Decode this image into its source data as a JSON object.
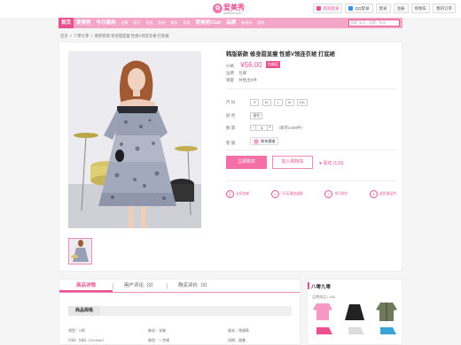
{
  "brand": {
    "name": "爱美秀",
    "domain": "aimeixiu.com"
  },
  "top_links": [
    {
      "label": "新浪登录",
      "color": "#e8508f"
    },
    {
      "label": "QQ登录",
      "color": "#3a8ee6"
    },
    {
      "label": "登录",
      "color": ""
    },
    {
      "label": "注册",
      "color": ""
    },
    {
      "label": "购物车",
      "color": ""
    },
    {
      "label": "我的订单",
      "color": ""
    }
  ],
  "nav": {
    "items": [
      {
        "label": "首页",
        "active": true,
        "big": true
      },
      {
        "label": "爱美秀",
        "big": true
      },
      {
        "label": "今日最热",
        "big": true
      },
      {
        "label": "衣服",
        "dim": true
      },
      {
        "label": "鞋子",
        "dim": true
      },
      {
        "label": "包包",
        "dim": true
      },
      {
        "label": "配饰",
        "dim": true
      },
      {
        "label": "美妆",
        "dim": true
      },
      {
        "label": "家居",
        "dim": true
      },
      {
        "label": "爱美居Club",
        "big": true
      },
      {
        "label": "品牌",
        "big": true
      },
      {
        "label": "聚相机",
        "dim": true
      },
      {
        "label": "团购",
        "dim": true
      }
    ],
    "search_placeholder": "搜索 宝贝，品牌，杂志"
  },
  "breadcrumb": [
    "首页",
    ">",
    "八零九零",
    ">",
    "韩新新款 修身甜显瘦 性感V领连衣裙 打底裙"
  ],
  "product": {
    "title": "韩版新款  修身甜显瘦  性感V领连衣裙  打底裙",
    "price_label": "价格",
    "price": "¥56.00",
    "price_tag": "包邮区",
    "shipping_label": "运费",
    "shipping_value": "包邮",
    "sales_label": "销量",
    "sales_value": "共售出0件",
    "size_label": "尺      码",
    "sizes": [
      "S",
      "M",
      "L",
      "XL",
      "XXL"
    ],
    "color_label": "颜      色",
    "color_value": "黄色",
    "qty_label": "数      量",
    "qty_minus": "-",
    "qty_value": "1",
    "qty_plus": "+",
    "stock": "（库存2499件）",
    "service_label": "客      服",
    "service_btn": "联系客服",
    "buy_label": "立即购买",
    "cart_label": "加入购物车",
    "fav_label": "喜欢",
    "fav_count": "(133)"
  },
  "badges": [
    {
      "icon": "正",
      "label": "全场包邮"
    },
    {
      "icon": "7",
      "label": "7天无理由退换"
    },
    {
      "icon": "√",
      "label": "先行赔付"
    },
    {
      "icon": "¥",
      "label": "退货退运险"
    }
  ],
  "detail_tabs": [
    {
      "label": "商品详情",
      "active": true
    },
    {
      "label": "用户评论（0）"
    },
    {
      "label": "购买评价（0）"
    }
  ],
  "spec_header": "商品规格",
  "specs": [
    [
      "领型：V领",
      "袖长：长袖",
      "裙长：常规款"
    ],
    [
      "尺码：均码（74×0cm）",
      "袖型：一字裙",
      "风格：甜美"
    ]
  ],
  "side": {
    "title": "八零九零",
    "brand_line": "品牌商品 | 185"
  },
  "colors": {
    "accent": "#e8508f",
    "nav_bg": "#f3a6c8",
    "button_bg": "#f36fa6"
  }
}
